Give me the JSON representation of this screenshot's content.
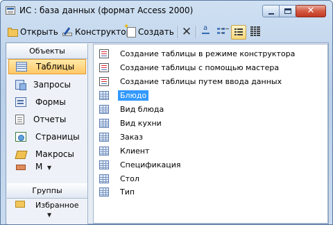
{
  "window": {
    "title": "ИС : база данных (формат Access 2000)"
  },
  "toolbar": {
    "open_label": "Открыть",
    "design_label": "Конструктор",
    "new_label": "Создать"
  },
  "left_pane": {
    "objects_header": "Объекты",
    "items": [
      {
        "label": "Таблицы",
        "icon": "tables-icon",
        "selected": true
      },
      {
        "label": "Запросы",
        "icon": "queries-icon"
      },
      {
        "label": "Формы",
        "icon": "forms-icon"
      },
      {
        "label": "Отчеты",
        "icon": "reports-icon"
      },
      {
        "label": "Страницы",
        "icon": "pages-icon"
      },
      {
        "label": "Макросы",
        "icon": "macros-icon"
      },
      {
        "label": "М",
        "icon": "modules-icon"
      }
    ],
    "groups_header": "Группы",
    "favorites_label": "Избранное"
  },
  "objects_list": {
    "items": [
      {
        "label": "Создание таблицы в режиме конструктора",
        "icon": "wizard-icon"
      },
      {
        "label": "Создание таблицы с помощью мастера",
        "icon": "wizard-icon"
      },
      {
        "label": "Создание таблицы путем ввода данных",
        "icon": "wizard-icon"
      },
      {
        "label": "Блюдо",
        "icon": "table-icon",
        "selected": true
      },
      {
        "label": "Вид блюда",
        "icon": "table-icon"
      },
      {
        "label": "Вид кухни",
        "icon": "table-icon"
      },
      {
        "label": "Заказ",
        "icon": "table-icon"
      },
      {
        "label": "Клиент",
        "icon": "table-icon"
      },
      {
        "label": "Спецификация",
        "icon": "table-icon"
      },
      {
        "label": "Стол",
        "icon": "table-icon"
      },
      {
        "label": "Тип",
        "icon": "table-icon"
      }
    ]
  },
  "colors": {
    "selection": "#3399ff",
    "highlight": "#ffc867",
    "close_button": "#c13b22"
  }
}
